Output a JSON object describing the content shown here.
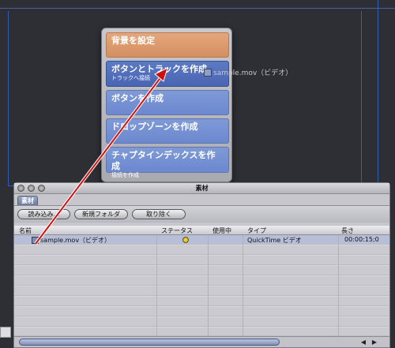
{
  "drop_menu": {
    "items": [
      {
        "label": "背景を設定",
        "sub": ""
      },
      {
        "label": "ボタンとトラックを作成",
        "sub": "トラックへ接続"
      },
      {
        "label": "ボタンを作成",
        "sub": ""
      },
      {
        "label": "ドロップゾーンを作成",
        "sub": ""
      },
      {
        "label": "チャプタインデックスを作成",
        "sub": "接続を作成"
      }
    ]
  },
  "drag_badge": {
    "label": "sample.mov（ビデオ）"
  },
  "window": {
    "title": "素材",
    "tab": "素材",
    "toolbar": {
      "import": "読み込み…",
      "new_folder": "新規フォルダ",
      "remove": "取り除く"
    },
    "columns": {
      "name": "名前",
      "status": "ステータス",
      "in_use": "使用中",
      "type": "タイプ",
      "length": "長さ"
    },
    "rows": [
      {
        "name": "sample.mov（ビデオ）",
        "type": "QuickTime ビデオ",
        "length": "00:00:15;0"
      }
    ],
    "scroll": {
      "left": "◀",
      "right": "▶"
    }
  },
  "colors": {
    "accent": "#5c79c4",
    "orange": "#d48f60",
    "arrow": "#d01010"
  }
}
